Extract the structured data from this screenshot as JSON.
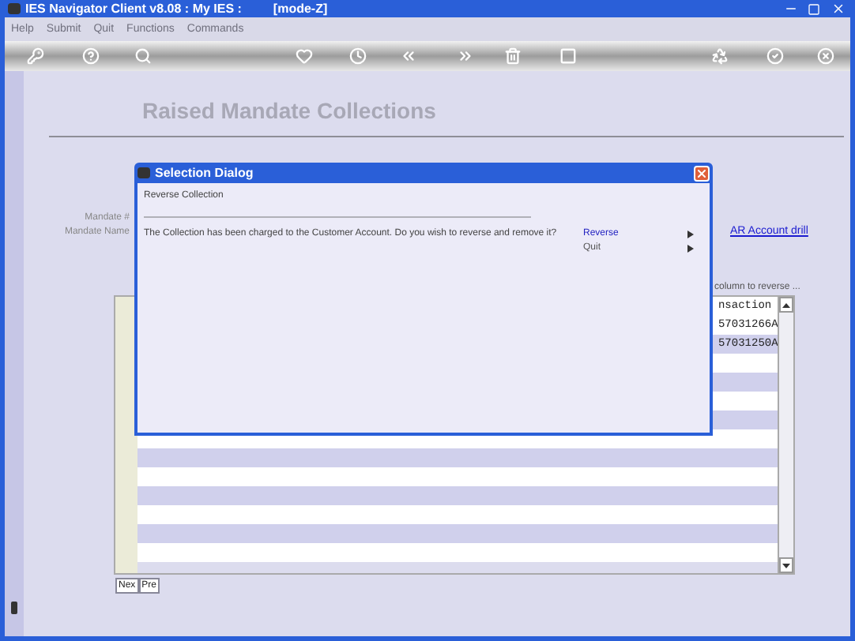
{
  "window": {
    "title": "IES Navigator Client v8.08 : My IES :         [mode-Z]"
  },
  "menu": [
    "Help",
    "Submit",
    "Quit",
    "Functions",
    "Commands"
  ],
  "page": {
    "title": "Raised Mandate Collections",
    "labels": [
      "Mandate #",
      "Mandate Name"
    ],
    "link": "AR Account drill",
    "hint": "column to reverse ..."
  },
  "table": {
    "header": "nsaction",
    "rows": [
      "57031266A",
      "57031250A"
    ]
  },
  "nav_buttons": [
    "Nex",
    "Pre"
  ],
  "dialog": {
    "title": "Selection Dialog",
    "heading": "Reverse Collection",
    "message": "The Collection has been charged to the Customer Account. Do you wish to reverse and remove it?",
    "options": [
      {
        "label": "Reverse",
        "selected": true
      },
      {
        "label": "Quit",
        "selected": false
      }
    ]
  }
}
